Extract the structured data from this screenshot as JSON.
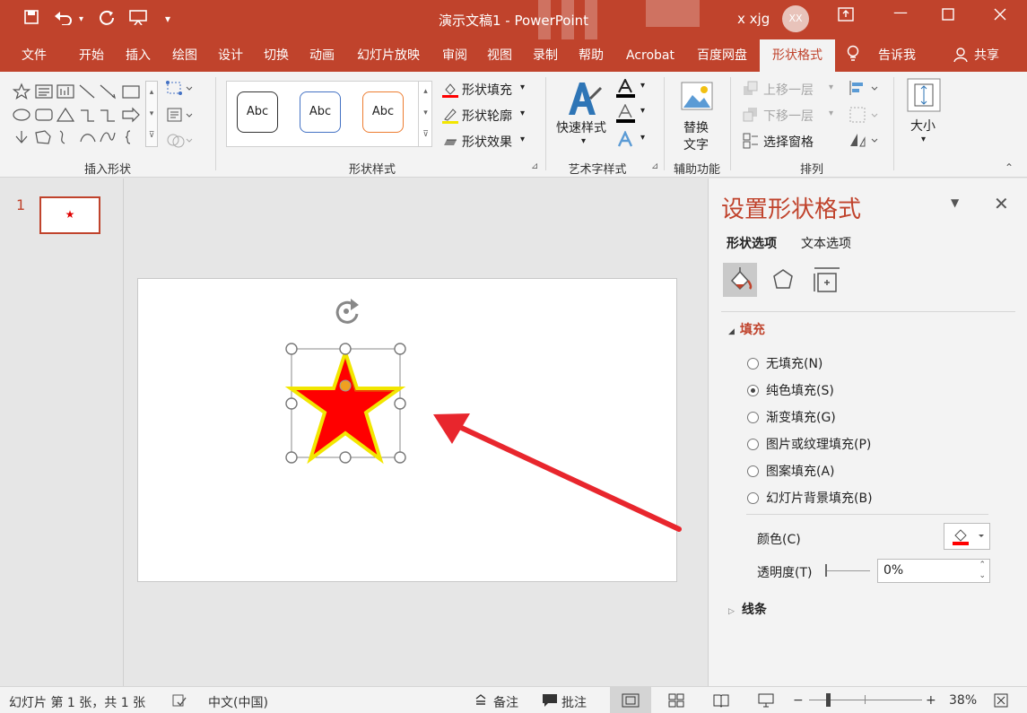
{
  "titlebar": {
    "title": "演示文稿1  -  PowerPoint",
    "user": "x xjg",
    "avatar": "XX",
    "quick_access_icons": [
      "save-icon",
      "undo-icon",
      "repeat-icon",
      "present-icon",
      "customize-icon"
    ],
    "window_buttons": [
      "ribbon-display-icon",
      "minimize-icon",
      "maximize-icon",
      "close-icon"
    ]
  },
  "tabs": [
    "文件",
    "开始",
    "插入",
    "绘图",
    "设计",
    "切换",
    "动画",
    "幻灯片放映",
    "审阅",
    "视图",
    "录制",
    "帮助",
    "Acrobat",
    "百度网盘",
    "形状格式",
    "告诉我",
    "共享"
  ],
  "active_tab": "形状格式",
  "ribbon": {
    "groups": {
      "insert_shapes": "插入形状",
      "shape_styles": "形状样式",
      "wordart": "艺术字样式",
      "accessibility": "辅助功能",
      "arrange": "排列"
    },
    "style_previews": [
      "Abc",
      "Abc",
      "Abc"
    ],
    "shape_fill": "形状填充",
    "shape_outline": "形状轮廓",
    "shape_effects": "形状效果",
    "quick_styles": "快速样式",
    "alt_text_line1": "替换",
    "alt_text_line2": "文字",
    "bring_forward": "上移一层",
    "send_backward": "下移一层",
    "selection_pane": "选择窗格",
    "size": "大小"
  },
  "slides_panel": {
    "slide_number": "1",
    "thumb_star": "★"
  },
  "format_pane": {
    "title": "设置形状格式",
    "tab_shape": "形状选项",
    "tab_text": "文本选项",
    "section_fill": "填充",
    "fill_options": [
      {
        "label": "无填充(N)",
        "checked": false
      },
      {
        "label": "纯色填充(S)",
        "checked": true
      },
      {
        "label": "渐变填充(G)",
        "checked": false
      },
      {
        "label": "图片或纹理填充(P)",
        "checked": false
      },
      {
        "label": "图案填充(A)",
        "checked": false
      },
      {
        "label": "幻灯片背景填充(B)",
        "checked": false
      }
    ],
    "color_label": "颜色(C)",
    "transparency_label": "透明度(T)",
    "transparency_value": "0%",
    "section_line": "线条"
  },
  "statusbar": {
    "slide_info": "幻灯片 第 1 张，共 1 张",
    "language": "中文(中国)",
    "notes": "备注",
    "comments": "批注",
    "zoom": "38%"
  },
  "colors": {
    "accent": "#c0432c",
    "star_fill": "#ff0000",
    "star_outline": "#f2e600",
    "arrow": "#e8262d"
  }
}
